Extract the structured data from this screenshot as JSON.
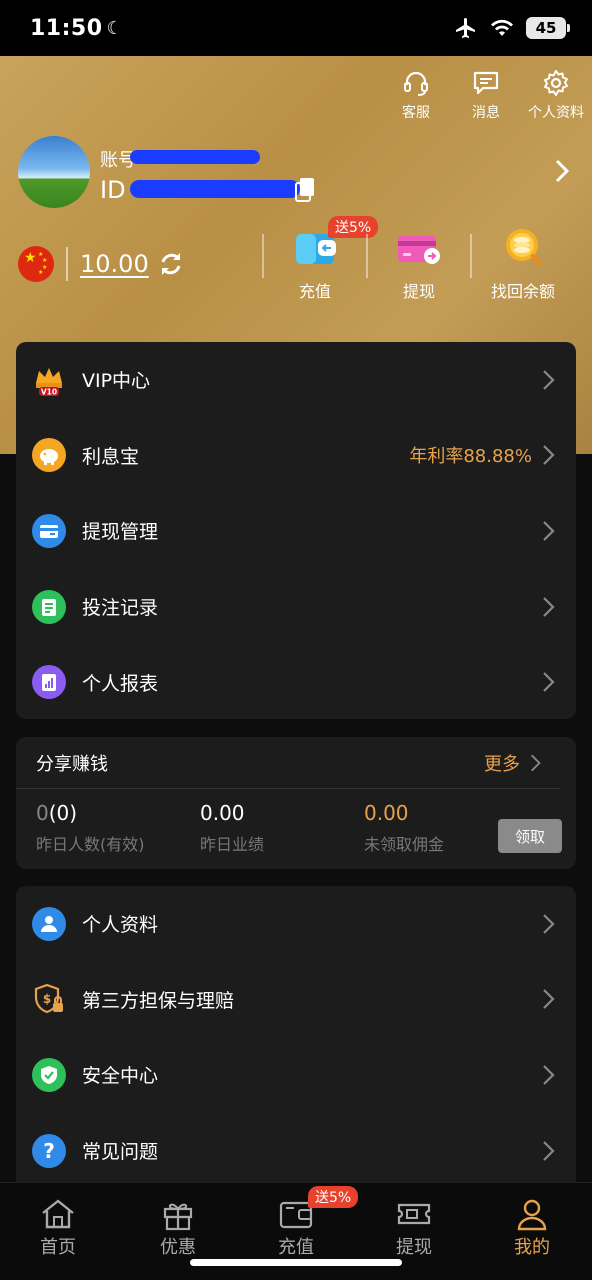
{
  "status_bar": {
    "time": "11:50",
    "battery": "45"
  },
  "header": {
    "icons": [
      {
        "label": "客服",
        "icon": "headset-icon"
      },
      {
        "label": "消息",
        "icon": "message-icon"
      },
      {
        "label": "个人资料",
        "icon": "gear-icon"
      }
    ],
    "account_label": "账号",
    "id_label": "ID",
    "balance": "10.00",
    "currency_flag": "china-flag",
    "actions": [
      {
        "label": "充值",
        "icon": "deposit-wallet-icon",
        "badge": "送5%"
      },
      {
        "label": "提现",
        "icon": "withdraw-card-icon"
      },
      {
        "label": "找回余额",
        "icon": "recover-coins-icon"
      }
    ]
  },
  "menu_primary": [
    {
      "label": "VIP中心",
      "icon": "vip-crown-icon",
      "badge": "V10"
    },
    {
      "label": "利息宝",
      "icon": "piggy-bank-icon",
      "extra": "年利率88.88%"
    },
    {
      "label": "提现管理",
      "icon": "card-icon"
    },
    {
      "label": "投注记录",
      "icon": "document-icon"
    },
    {
      "label": "个人报表",
      "icon": "report-icon"
    }
  ],
  "share": {
    "title": "分享赚钱",
    "more": "更多",
    "stats": [
      {
        "value_dim": "0",
        "value": "(0)",
        "caption": "昨日人数(有效)"
      },
      {
        "value": "0.00",
        "caption": "昨日业绩"
      },
      {
        "value": "0.00",
        "caption": "未领取佣金"
      }
    ],
    "claim": "领取"
  },
  "menu_secondary": [
    {
      "label": "个人资料",
      "icon": "user-icon"
    },
    {
      "label": "第三方担保与理赔",
      "icon": "shield-lock-icon"
    },
    {
      "label": "安全中心",
      "icon": "shield-check-icon"
    },
    {
      "label": "常见问题",
      "icon": "question-icon"
    }
  ],
  "tabbar": [
    {
      "label": "首页",
      "icon": "home-icon"
    },
    {
      "label": "优惠",
      "icon": "gift-icon"
    },
    {
      "label": "充值",
      "icon": "wallet-icon",
      "badge": "送5%"
    },
    {
      "label": "提现",
      "icon": "ticket-icon"
    },
    {
      "label": "我的",
      "icon": "user-icon",
      "active": true
    }
  ],
  "colors": {
    "gold": "#e8a24c",
    "header_bg": "#c39d56",
    "card_bg": "#1c1c1c",
    "badge_red": "#e8412c"
  }
}
